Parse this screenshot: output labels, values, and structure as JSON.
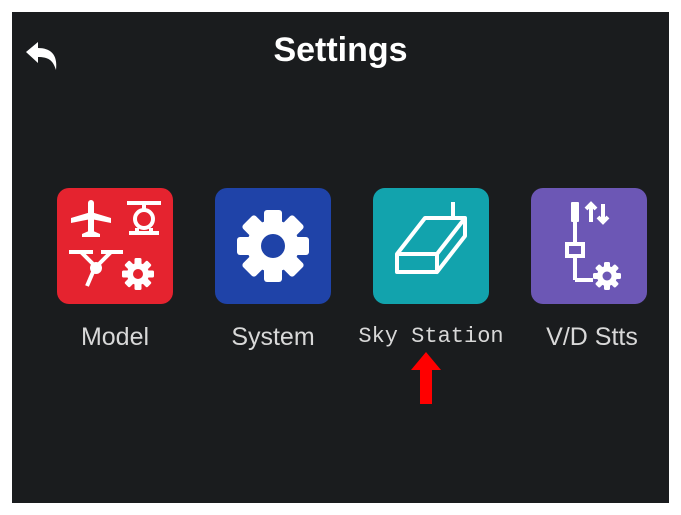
{
  "header": {
    "title": "Settings",
    "back_icon": "back-arrow-icon"
  },
  "menu": {
    "items": [
      {
        "label": "Model",
        "icon": "model-aircraft-icon",
        "color": "#e5232f"
      },
      {
        "label": "System",
        "icon": "gear-icon",
        "color": "#1f43a8"
      },
      {
        "label": "Sky Station",
        "icon": "sky-station-icon",
        "color": "#12a3ad"
      },
      {
        "label": "V/D Stts",
        "icon": "vd-settings-icon",
        "color": "#6c57b5"
      }
    ]
  },
  "annotation": {
    "icon": "red-up-arrow-icon",
    "color": "#ff0000"
  },
  "colors": {
    "screen_background": "#1a1c1e",
    "text": "#ffffff"
  }
}
